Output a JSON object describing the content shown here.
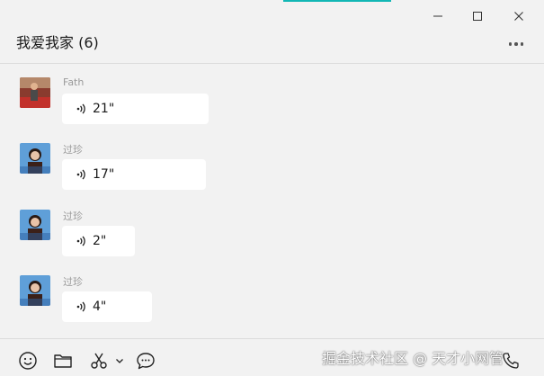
{
  "window": {
    "title": "我爱我家 (6)",
    "controls": [
      "minimize-icon",
      "maximize-icon",
      "close-icon"
    ]
  },
  "header": {
    "more_icon": "more-dots-icon"
  },
  "messages": [
    {
      "sender": "Fath",
      "duration": "21\"",
      "icon": "voice-icon"
    },
    {
      "sender": "过珍",
      "duration": "17\"",
      "icon": "voice-icon"
    },
    {
      "sender": "过珍",
      "duration": "2\"",
      "icon": "voice-icon"
    },
    {
      "sender": "过珍",
      "duration": "4\"",
      "icon": "voice-icon"
    }
  ],
  "toolbar": {
    "items": [
      "emoji-icon",
      "folder-icon",
      "scissors-icon",
      "chevron-down-icon",
      "chat-history-icon",
      "phone-icon"
    ]
  },
  "watermark": "掘金技术社区 @ 天才小网管",
  "colors": {
    "background": "#f2f2f2",
    "bubble": "#ffffff",
    "accent": "#12b7b5"
  }
}
